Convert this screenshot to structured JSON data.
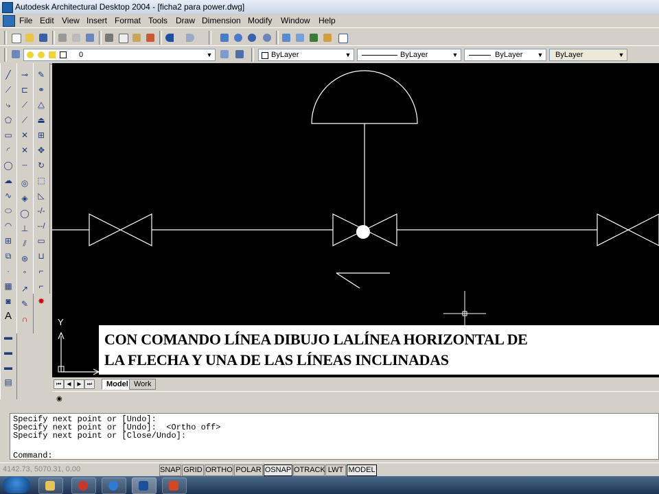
{
  "window": {
    "title": "Autodesk Architectural Desktop 2004 - [ficha2 para power.dwg]"
  },
  "menu": [
    "File",
    "Edit",
    "View",
    "Insert",
    "Format",
    "Tools",
    "Draw",
    "Dimension",
    "Modify",
    "Window",
    "Help"
  ],
  "layers_toolbar": {
    "layer_value": "0"
  },
  "properties_toolbar": {
    "color": "ByLayer",
    "linetype": "ByLayer",
    "lineweight": "ByLayer",
    "plotstyle": "ByLayer"
  },
  "drawing": {
    "ucs_y_label": "Y",
    "caption": [
      "CON COMANDO LÍNEA DIBUJO LALÍNEA HORIZONTAL DE",
      "LA FLECHA Y UNA DE LAS LÍNEAS INCLINADAS"
    ]
  },
  "layout_tabs": {
    "model": "Model",
    "work": "Work"
  },
  "command_window": {
    "history": [
      "Specify next point or [Undo]:",
      "Specify next point or [Undo]:  <Ortho off>",
      "Specify next point or [Close/Undo]:"
    ],
    "prompt": "Command:"
  },
  "status_bar": {
    "coordinates": "4142.73, 5070.31, 0.00",
    "toggles": [
      "SNAP",
      "GRID",
      "ORTHO",
      "POLAR",
      "OSNAP",
      "OTRACK",
      "LWT",
      "MODEL"
    ]
  },
  "colors": {
    "drawing_background": "#000000",
    "drawing_lines": "#ffffff",
    "chrome": "#d4d0c8"
  },
  "icons": {
    "standard_toolbar": [
      "new-icon",
      "open-icon",
      "save-icon",
      "print-icon",
      "plot-preview-icon",
      "publish-icon",
      "cut-icon",
      "copy-icon",
      "paste-icon",
      "match-properties-icon",
      "undo-icon",
      "redo-icon",
      "pan-icon",
      "zoom-realtime-icon",
      "zoom-window-icon",
      "zoom-previous-icon",
      "properties-icon",
      "designcenter-icon",
      "tool-palettes-icon",
      "help-icon"
    ],
    "draw_toolbar": [
      "line-icon",
      "construction-line-icon",
      "polyline-icon",
      "polygon-icon",
      "rectangle-icon",
      "arc-icon",
      "circle-icon",
      "revision-cloud-icon",
      "spline-icon",
      "ellipse-icon",
      "ellipse-arc-icon",
      "insert-block-icon",
      "make-block-icon",
      "point-icon",
      "hatch-icon",
      "region-icon",
      "multiline-text-icon"
    ],
    "modify_toolbar": [
      "erase-icon",
      "copy-object-icon",
      "mirror-icon",
      "offset-icon",
      "array-icon",
      "move-icon",
      "rotate-icon",
      "scale-icon",
      "stretch-icon",
      "trim-icon",
      "extend-icon",
      "break-icon",
      "join-icon",
      "chamfer-icon",
      "fillet-icon",
      "explode-icon"
    ]
  }
}
